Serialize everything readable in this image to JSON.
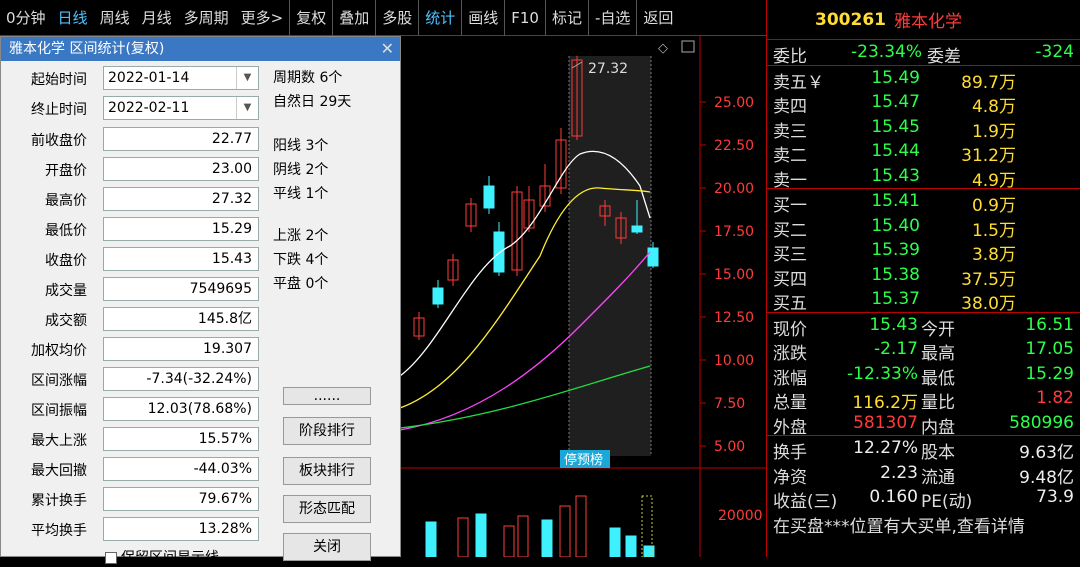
{
  "toolbar": {
    "items": [
      "0分钟",
      "日线",
      "周线",
      "月线",
      "多周期",
      "更多>",
      "复权",
      "叠加",
      "多股",
      "统计",
      "画线",
      "F10",
      "标记",
      "-自选",
      "返回"
    ]
  },
  "chart": {
    "y_labels": [
      "25.00",
      "22.50",
      "20.00",
      "17.50",
      "15.00",
      "12.50",
      "10.00",
      "7.50",
      "5.00"
    ],
    "high_label": "27.32",
    "tag": "停预榜",
    "vol_label": "20000",
    "colors": {
      "up": "#ff3b3b",
      "down": "#3ff0ff",
      "ma1": "#ffffff",
      "ma2": "#ffee33",
      "ma3": "#ff44ff",
      "ma4": "#22dd44"
    }
  },
  "quote": {
    "code": "300261",
    "name": "雅本化学",
    "weibi_label": "委比",
    "weibi_value": "-23.34%",
    "weicha_label": "委差",
    "weicha_value": "-324",
    "sells": [
      {
        "label": "卖五￥",
        "price": "15.49",
        "vol": "89.7万"
      },
      {
        "label": "卖四",
        "price": "15.47",
        "vol": "4.8万"
      },
      {
        "label": "卖三",
        "price": "15.45",
        "vol": "1.9万"
      },
      {
        "label": "卖二",
        "price": "15.44",
        "vol": "31.2万"
      },
      {
        "label": "卖一",
        "price": "15.43",
        "vol": "4.9万"
      }
    ],
    "buys": [
      {
        "label": "买一",
        "price": "15.41",
        "vol": "0.9万"
      },
      {
        "label": "买二",
        "price": "15.40",
        "vol": "1.5万"
      },
      {
        "label": "买三",
        "price": "15.39",
        "vol": "3.8万"
      },
      {
        "label": "买四",
        "price": "15.38",
        "vol": "37.5万"
      },
      {
        "label": "买五",
        "price": "15.37",
        "vol": "38.0万"
      }
    ],
    "stats": [
      {
        "l1": "现价",
        "v1": "15.43",
        "c1": "green",
        "l2": "今开",
        "v2": "16.51",
        "c2": "green"
      },
      {
        "l1": "涨跌",
        "v1": "-2.17",
        "c1": "green",
        "l2": "最高",
        "v2": "17.05",
        "c2": "green"
      },
      {
        "l1": "涨幅",
        "v1": "-12.33%",
        "c1": "green",
        "l2": "最低",
        "v2": "15.29",
        "c2": "green"
      },
      {
        "l1": "总量",
        "v1": "116.2万",
        "c1": "yellow",
        "l2": "量比",
        "v2": "1.82",
        "c2": "red"
      },
      {
        "l1": "外盘",
        "v1": "581307",
        "c1": "red",
        "l2": "内盘",
        "v2": "580996",
        "c2": "green"
      }
    ],
    "stats2": [
      {
        "l1": "换手",
        "v1": "12.27%",
        "l2": "股本",
        "v2": "9.63亿"
      },
      {
        "l1": "净资",
        "v1": "2.23",
        "l2": "流通",
        "v2": "9.48亿"
      },
      {
        "l1": "收益(三)",
        "v1": "0.160",
        "l2": "PE(动)",
        "v2": "73.9"
      }
    ],
    "footer": "在买盘***位置有大买单,查看详情"
  },
  "dialog": {
    "title": "雅本化学 区间统计(复权)",
    "start_label": "起始时间",
    "start_value": "2022-01-14",
    "end_label": "终止时间",
    "end_value": "2022-02-11",
    "fields": [
      {
        "label": "前收盘价",
        "value": "22.77"
      },
      {
        "label": "开盘价",
        "value": "23.00"
      },
      {
        "label": "最高价",
        "value": "27.32"
      },
      {
        "label": "最低价",
        "value": "15.29"
      },
      {
        "label": "收盘价",
        "value": "15.43"
      },
      {
        "label": "成交量",
        "value": "7549695"
      },
      {
        "label": "成交额",
        "value": "145.8亿"
      },
      {
        "label": "加权均价",
        "value": "19.307"
      },
      {
        "label": "区间涨幅",
        "value": "-7.34(-32.24%)"
      },
      {
        "label": "区间振幅",
        "value": "12.03(78.68%)"
      },
      {
        "label": "最大上涨",
        "value": "15.57%"
      },
      {
        "label": "最大回撤",
        "value": "-44.03%"
      },
      {
        "label": "累计换手",
        "value": "79.67%"
      },
      {
        "label": "平均换手",
        "value": "13.28%"
      }
    ],
    "stats": [
      "周期数 6个",
      "自然日 29天",
      "阳线 3个",
      "阴线 2个",
      "平线 1个",
      "上涨 2个",
      "下跌 4个",
      "平盘 0个"
    ],
    "buttons": [
      "......",
      "阶段排行",
      "板块排行",
      "形态匹配",
      "关闭"
    ],
    "checkbox_label": "保留区间显示线"
  }
}
